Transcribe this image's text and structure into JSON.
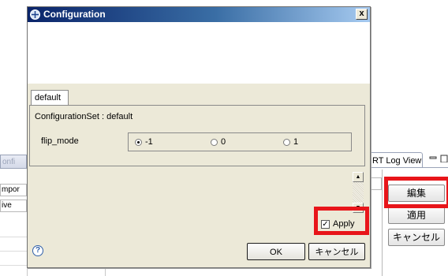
{
  "background": {
    "left_tab_label": "onfi",
    "left_rows": [
      "mpor",
      "ive"
    ],
    "right_tab_label": "RT Log View",
    "side_buttons": {
      "edit": "編集",
      "apply": "適用",
      "cancel": "キャンセル"
    }
  },
  "dialog": {
    "title": "Configuration",
    "close_glyph": "x",
    "tab_label": "default",
    "configuration_set": "ConfigurationSet : default",
    "param_name": "flip_mode",
    "radio_options": [
      {
        "label": "-1",
        "checked": true
      },
      {
        "label": "0",
        "checked": false
      },
      {
        "label": "1",
        "checked": false
      }
    ],
    "apply_label": "Apply",
    "apply_checked": true,
    "apply_mark": "✓",
    "help_glyph": "?",
    "ok_label": "OK",
    "cancel_label": "キャンセル"
  },
  "highlight_color": "#e8151a"
}
